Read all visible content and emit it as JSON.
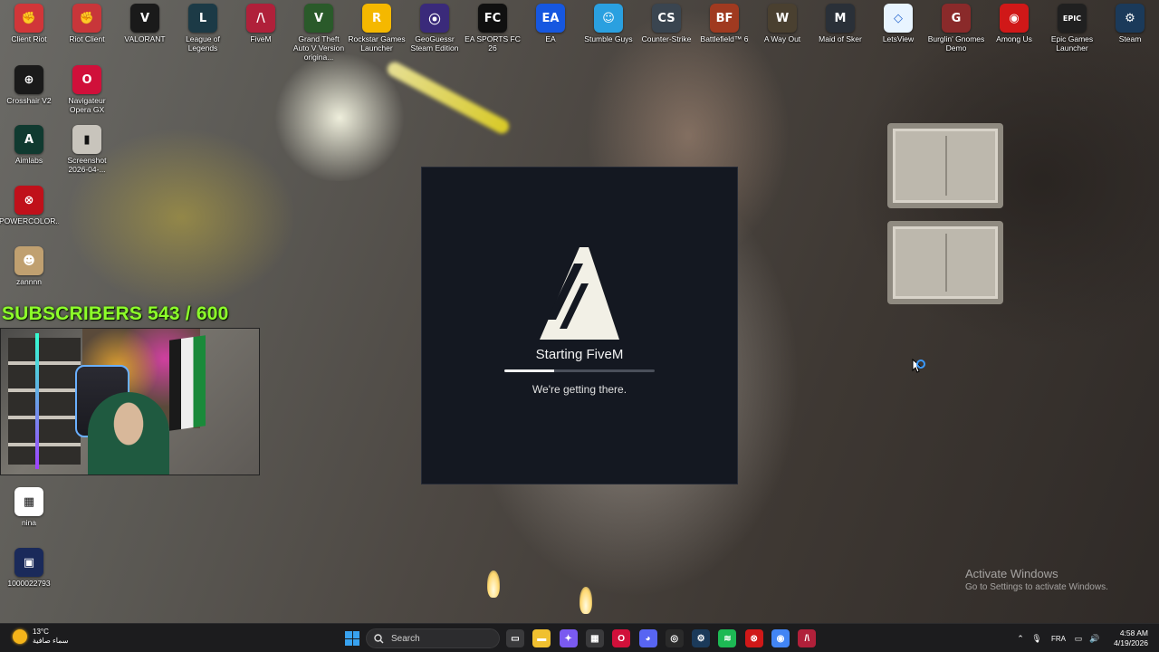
{
  "desktop": {
    "top_row": [
      {
        "label": "Client Riot",
        "icon": "riot-fist-icon",
        "color": "#d13639",
        "glyph": "✊"
      },
      {
        "label": "Riot Client",
        "icon": "riot-fist-icon",
        "color": "#c8363a",
        "glyph": "✊"
      },
      {
        "label": "VALORANT",
        "icon": "valorant-icon",
        "color": "#1a1a1a",
        "glyph": "V"
      },
      {
        "label": "League of Legends",
        "icon": "league-of-legends-icon",
        "color": "#1c3a46",
        "glyph": "L"
      },
      {
        "label": "FiveM",
        "icon": "fivem-icon",
        "color": "#b0203a",
        "glyph": "/\\"
      },
      {
        "label": "Grand Theft Auto V Version origina...",
        "icon": "gta-v-icon",
        "color": "#2a5a2a",
        "glyph": "V"
      },
      {
        "label": "Rockstar Games Launcher",
        "icon": "rockstar-icon",
        "color": "#f5b800",
        "glyph": "R"
      },
      {
        "label": "GeoGuessr Steam Edition",
        "icon": "geoguessr-icon",
        "color": "#3a2a7a",
        "glyph": "⦿"
      },
      {
        "label": "EA SPORTS FC 26",
        "icon": "ea-fc-icon",
        "color": "#101010",
        "glyph": "FC"
      },
      {
        "label": "EA",
        "icon": "ea-icon",
        "color": "#1657e0",
        "glyph": "EA"
      },
      {
        "label": "Stumble Guys",
        "icon": "stumble-guys-icon",
        "color": "#2aa0e0",
        "glyph": "☺"
      },
      {
        "label": "Counter-Strike",
        "icon": "counter-strike-icon",
        "color": "#3a4550",
        "glyph": "CS"
      },
      {
        "label": "Battlefield™ 6",
        "icon": "battlefield-icon",
        "color": "#a03a20",
        "glyph": "BF"
      },
      {
        "label": "A Way Out",
        "icon": "a-way-out-icon",
        "color": "#4a4030",
        "glyph": "W"
      },
      {
        "label": "Maid of Sker",
        "icon": "maid-of-sker-icon",
        "color": "#2a3038",
        "glyph": "M"
      },
      {
        "label": "LetsView",
        "icon": "letsview-icon",
        "color": "#e8f4ff",
        "glyph": "◇"
      },
      {
        "label": "Burglin' Gnomes Demo",
        "icon": "burglin-gnomes-icon",
        "color": "#8a2a2a",
        "glyph": "G"
      },
      {
        "label": "Among Us",
        "icon": "among-us-icon",
        "color": "#d01818",
        "glyph": "◉"
      },
      {
        "label": "Epic Games Launcher",
        "icon": "epic-games-icon",
        "color": "#202020",
        "glyph": "EPIC"
      },
      {
        "label": "Steam",
        "icon": "steam-icon",
        "color": "#1b3a5a",
        "glyph": "⚙"
      }
    ],
    "left_column": [
      {
        "label": "Crosshair V2",
        "icon": "crosshair-icon",
        "color": "#1a1a1a",
        "glyph": "⊕"
      },
      {
        "label": "Navigateur Opera GX",
        "icon": "opera-gx-icon",
        "color": "#d0103a",
        "glyph": "O"
      },
      {
        "label": "Aimlabs",
        "icon": "aimlabs-icon",
        "color": "#103a30",
        "glyph": "A"
      },
      {
        "label": "Screenshot 2026-04-...",
        "icon": "screenshot-thumbnail-icon",
        "color": "#c8c4bc",
        "glyph": "▮"
      },
      {
        "label": "POWERCOLOR...",
        "icon": "powercolor-icon",
        "color": "#c0101a",
        "glyph": "⊗"
      },
      {
        "label": "zannnn",
        "icon": "photo-thumbnail-icon",
        "color": "#c0a070",
        "glyph": "☻"
      },
      {
        "label": "nina",
        "icon": "qr-code-icon",
        "color": "#ffffff",
        "glyph": "▦"
      },
      {
        "label": "1000022793",
        "icon": "image-thumbnail-icon",
        "color": "#1a2a5a",
        "glyph": "▣"
      }
    ]
  },
  "stream_overlay": {
    "subscribers_text": "SUBSCRIBERS 543 / 600",
    "accent_color": "#8dff2a"
  },
  "launcher": {
    "title": "Starting FiveM",
    "subtitle": "We're getting there.",
    "progress_fraction": 0.33,
    "logo_icon": "fivem-logo-icon",
    "background_color": "#141821"
  },
  "watermark": {
    "line1": "Activate Windows",
    "line2": "Go to Settings to activate Windows."
  },
  "taskbar": {
    "weather_temp": "13°C",
    "weather_desc": "سماء صافية",
    "search_placeholder": "Search",
    "apps": [
      {
        "name": "task-view-icon",
        "color": "#3a3a3c",
        "glyph": "▭"
      },
      {
        "name": "file-explorer-icon",
        "color": "#f0c030",
        "glyph": "▬"
      },
      {
        "name": "copilot-icon",
        "color": "#7a5af0",
        "glyph": "✦"
      },
      {
        "name": "microsoft-store-icon",
        "color": "#3a3a3c",
        "glyph": "▦"
      },
      {
        "name": "opera-gx-icon",
        "color": "#d0103a",
        "glyph": "O"
      },
      {
        "name": "discord-icon",
        "color": "#5865f2",
        "glyph": "◕"
      },
      {
        "name": "obs-icon",
        "color": "#2a2a2a",
        "glyph": "◎"
      },
      {
        "name": "steam-icon",
        "color": "#1b3a5a",
        "glyph": "⚙"
      },
      {
        "name": "spotify-icon",
        "color": "#1db954",
        "glyph": "≋"
      },
      {
        "name": "record-app-icon",
        "color": "#d01818",
        "glyph": "⊗"
      },
      {
        "name": "chrome-icon",
        "color": "#4285f4",
        "glyph": "◉"
      },
      {
        "name": "fivem-icon",
        "color": "#b0203a",
        "glyph": "/\\"
      }
    ],
    "language": "FRA",
    "time": "4:58 AM",
    "date": "4/19/2026"
  }
}
